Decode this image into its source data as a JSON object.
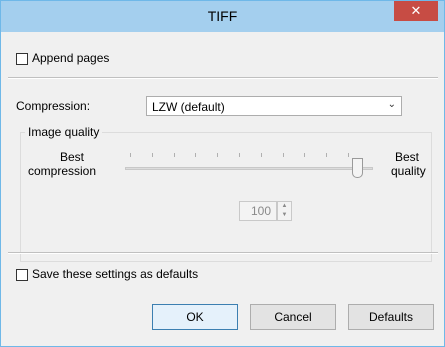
{
  "window": {
    "title": "TIFF",
    "close_glyph": "✕"
  },
  "append_pages": {
    "label": "Append pages",
    "checked": false
  },
  "compression": {
    "label": "Compression:",
    "selected": "LZW (default)"
  },
  "image_quality": {
    "group_label": "Image quality",
    "left_label_line1": "Best",
    "left_label_line2": "compression",
    "right_label_line1": "Best",
    "right_label_line2": "quality",
    "value": "100",
    "slider_level": 1.0
  },
  "save_defaults": {
    "label": "Save these settings as defaults",
    "checked": false
  },
  "buttons": {
    "ok": "OK",
    "cancel": "Cancel",
    "defaults": "Defaults"
  },
  "colors": {
    "titlebar": "#a4cfee",
    "close_button": "#c74c44",
    "window_border": "#6fb8e8"
  }
}
